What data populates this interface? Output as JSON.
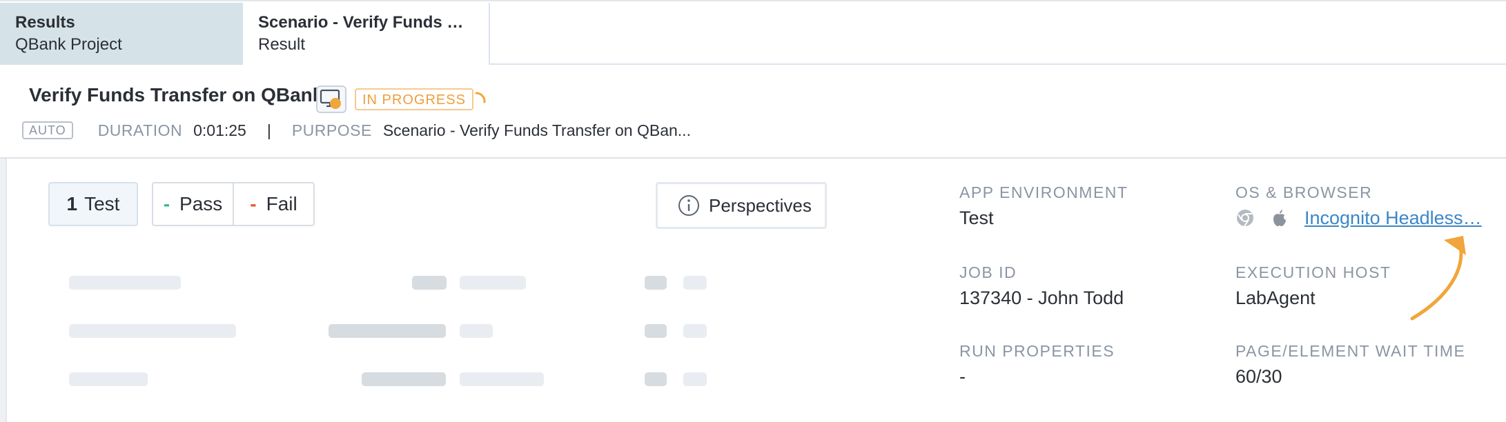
{
  "tabs": [
    {
      "title": "Results",
      "subtitle": "QBank Project"
    },
    {
      "title": "Scenario - Verify Funds …",
      "subtitle": "Result"
    }
  ],
  "header": {
    "title": "Verify Funds Transfer on QBank",
    "status": "IN PROGRESS",
    "mode_badge": "AUTO",
    "duration_label": "DURATION",
    "duration_value": "0:01:25",
    "separator": "|",
    "purpose_label": "PURPOSE",
    "purpose_value": "Scenario - Verify Funds Transfer on QBan..."
  },
  "filters": {
    "test_count": "1",
    "test_label": "Test",
    "pass_dash": "-",
    "pass_label": "Pass",
    "fail_dash": "-",
    "fail_label": "Fail",
    "perspectives_label": "Perspectives"
  },
  "details": {
    "app_env_label": "APP ENVIRONMENT",
    "app_env_value": "Test",
    "os_browser_label": "OS & BROWSER",
    "browser_link": "Incognito Headless…",
    "job_id_label": "JOB ID",
    "job_id_value": "137340 - John Todd",
    "exec_host_label": "EXECUTION HOST",
    "exec_host_value": "LabAgent",
    "run_props_label": "RUN PROPERTIES",
    "run_props_value": "-",
    "wait_time_label": "PAGE/ELEMENT WAIT TIME",
    "wait_time_value": "60/30"
  },
  "icons": [
    "monitor-icon",
    "spinner-icon",
    "info-icon",
    "chrome-icon",
    "apple-icon",
    "annotation-arrow"
  ],
  "colors": {
    "accent_orange": "#f0a63a",
    "link_blue": "#3a86c8",
    "pass_green": "#3bb78f",
    "fail_red": "#e4572e",
    "active_tab_bg": "#d5e3e8"
  }
}
